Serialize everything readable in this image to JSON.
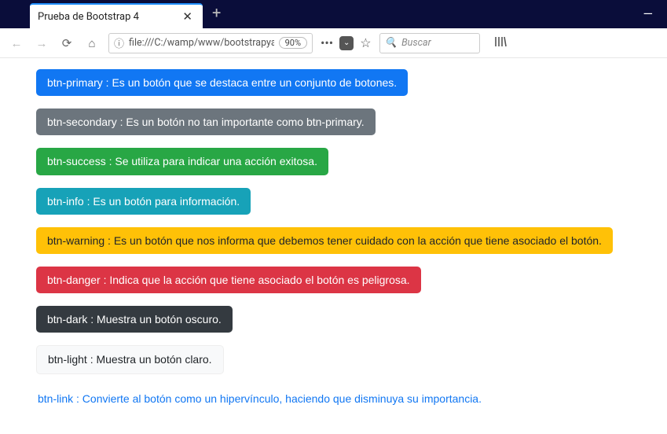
{
  "window": {
    "tab_title": "Prueba de Bootstrap 4",
    "minimize": "—"
  },
  "toolbar": {
    "url": "file:///C:/wamp/www/bootstrapya/pa",
    "zoom": "90%",
    "search_placeholder": "Buscar"
  },
  "buttons": {
    "primary": "btn-primary : Es un botón que se destaca entre un conjunto de botones.",
    "secondary": "btn-secondary : Es un botón no tan importante como btn-primary.",
    "success": "btn-success : Se utiliza para indicar una acción exitosa.",
    "info": "btn-info : Es un botón para información.",
    "warning": "btn-warning : Es un botón que nos informa que debemos tener cuidado con la acción que tiene asociado el botón.",
    "danger": "btn-danger : Indica que la acción que tiene asociado el botón es peligrosa.",
    "dark": "btn-dark : Muestra un botón oscuro.",
    "light": "btn-light : Muestra un botón claro.",
    "link": "btn-link : Convierte al botón como un hipervínculo, haciendo que disminuya su importancia."
  }
}
